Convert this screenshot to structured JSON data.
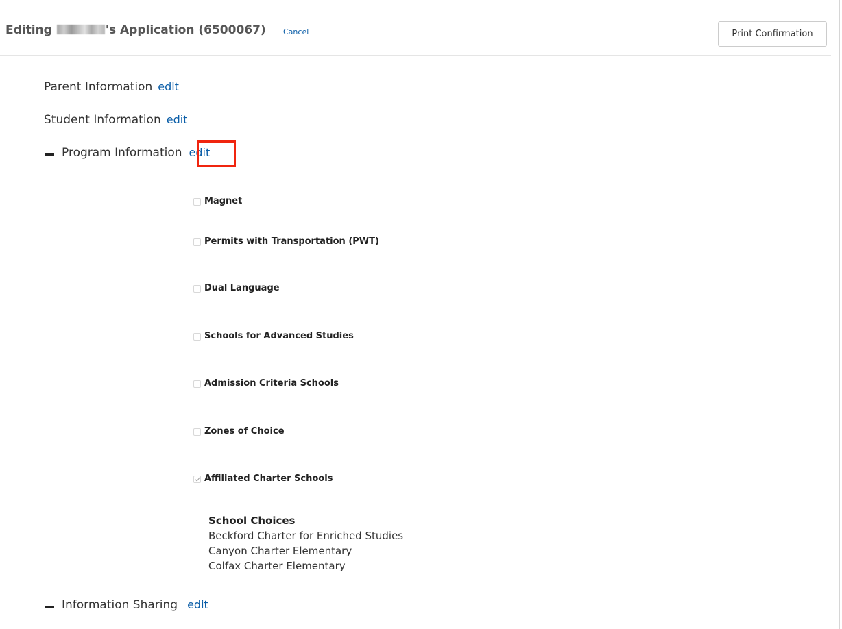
{
  "header": {
    "title_prefix": "Editing",
    "title_suffix": "'s Application (6500067)",
    "cancel_label": "Cancel",
    "print_button_label": "Print Confirmation"
  },
  "sections": {
    "parent": {
      "label": "Parent Information",
      "edit_label": "edit"
    },
    "student": {
      "label": "Student Information",
      "edit_label": "edit"
    },
    "program": {
      "label": "Program Information",
      "edit_label": "edit",
      "expanded": true
    },
    "sharing": {
      "label": "Information Sharing",
      "edit_label": "edit",
      "expanded": true
    }
  },
  "programs": [
    {
      "label": "Magnet",
      "checked": false
    },
    {
      "label": "Permits with Transportation (PWT)",
      "checked": false
    },
    {
      "label": "Dual Language",
      "checked": false
    },
    {
      "label": "Schools for Advanced Studies",
      "checked": false
    },
    {
      "label": "Admission Criteria Schools",
      "checked": false
    },
    {
      "label": "Zones of Choice",
      "checked": false
    },
    {
      "label": "Affiliated Charter Schools",
      "checked": true
    }
  ],
  "school_choices": {
    "title": "School Choices",
    "items": [
      "Beckford Charter for Enriched Studies",
      "Canyon Charter Elementary",
      "Colfax Charter Elementary"
    ]
  },
  "colors": {
    "link": "#0b5ea8",
    "highlight": "#f0250f"
  }
}
